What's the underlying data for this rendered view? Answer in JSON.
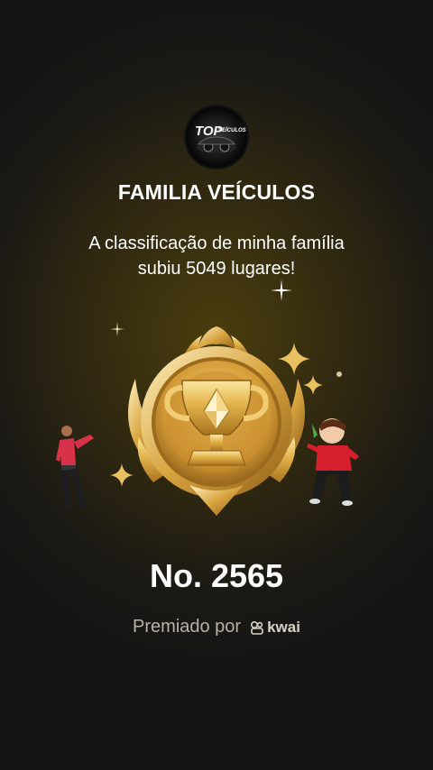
{
  "logo": {
    "text_top": "TOP",
    "text_sub": "VEÍCULOS",
    "icon": "top-veiculos-logo"
  },
  "header": {
    "family_name": "FAMILIA VEÍCULOS"
  },
  "message": {
    "line1": "A classificação de minha família",
    "line2": "subiu 5049 lugares!"
  },
  "badge": {
    "icon": "trophy-icon"
  },
  "rank": {
    "label": "No. 2565"
  },
  "footer": {
    "awarded_by": "Premiado por",
    "brand": "kwai",
    "brand_icon": "kwai-logo-icon"
  },
  "colors": {
    "gold": "#e2b24a",
    "text": "#ffffff",
    "muted": "#b8b2a6"
  }
}
